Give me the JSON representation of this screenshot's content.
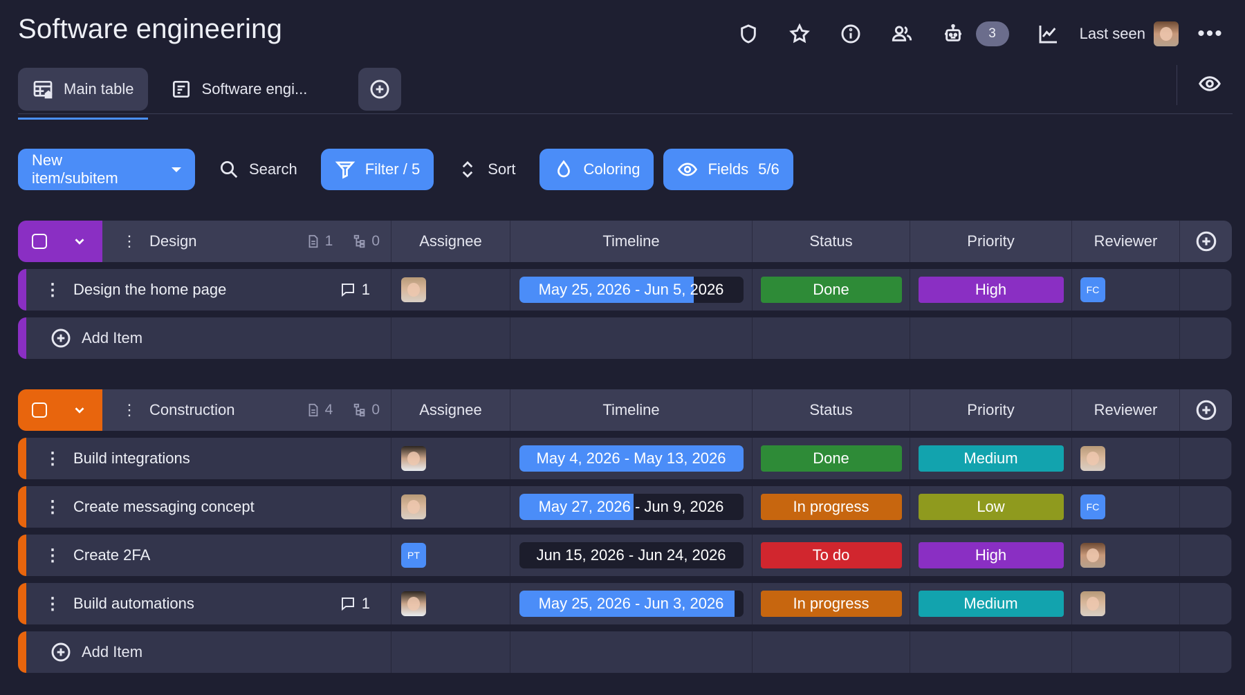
{
  "title": "Software engineering",
  "header": {
    "automations_count": "3",
    "last_seen_label": "Last seen"
  },
  "tabs": [
    {
      "label": "Main table"
    },
    {
      "label": "Software engi..."
    }
  ],
  "toolbar": {
    "new_item_label": "New item/subitem",
    "search_label": "Search",
    "filter_label": "Filter / 5",
    "sort_label": "Sort",
    "coloring_label": "Coloring",
    "fields_label": "Fields",
    "fields_count": "5/6"
  },
  "columns": {
    "assignee": "Assignee",
    "timeline": "Timeline",
    "status": "Status",
    "priority": "Priority",
    "reviewer": "Reviewer"
  },
  "add_item_label": "Add Item",
  "colors": {
    "accent_blue": "#4b8df8",
    "design_group": "#8a2fc3",
    "construction_group": "#e8650d",
    "status_done": "#2e8b37",
    "status_in_progress": "#c7660f",
    "status_todo": "#d1262e",
    "priority_high": "#8a2fc3",
    "priority_medium": "#12a3ae",
    "priority_low": "#8f9a1e"
  },
  "groups": [
    {
      "name": "Design",
      "items_count": "1",
      "subitems_count": "0",
      "rows": [
        {
          "name": "Design the home page",
          "comments": "1",
          "assignee": "avatar",
          "timeline": "May 25, 2026 - Jun 5, 2026",
          "timeline_progress": 0.78,
          "status": "Done",
          "priority": "High",
          "reviewer": "FC"
        }
      ]
    },
    {
      "name": "Construction",
      "items_count": "4",
      "subitems_count": "0",
      "rows": [
        {
          "name": "Build integrations",
          "comments": "",
          "assignee": "avatar",
          "timeline": "May 4, 2026 - May 13, 2026",
          "timeline_progress": 1.0,
          "status": "Done",
          "priority": "Medium",
          "reviewer": "avatar"
        },
        {
          "name": "Create messaging concept",
          "comments": "",
          "assignee": "avatar",
          "timeline": "May 27, 2026 - Jun 9, 2026",
          "timeline_progress": 0.51,
          "status": "In progress",
          "priority": "Low",
          "reviewer": "FC"
        },
        {
          "name": "Create 2FA",
          "comments": "",
          "assignee": "PT",
          "timeline": "Jun 15, 2026 - Jun 24, 2026",
          "timeline_progress": 0.0,
          "status": "To do",
          "priority": "High",
          "reviewer": "avatar"
        },
        {
          "name": "Build automations",
          "comments": "1",
          "assignee": "avatar",
          "timeline": "May 25, 2026 - Jun 3, 2026",
          "timeline_progress": 0.96,
          "status": "In progress",
          "priority": "Medium",
          "reviewer": "avatar"
        }
      ]
    }
  ]
}
